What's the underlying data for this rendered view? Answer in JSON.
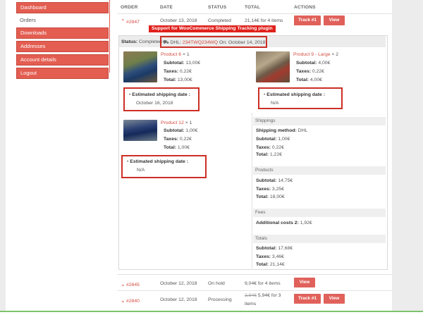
{
  "sidebar": {
    "items": [
      {
        "label": "Dashboard",
        "active": true
      },
      {
        "label": "Orders",
        "active": false
      },
      {
        "label": "Downloads",
        "active": true
      },
      {
        "label": "Addresses",
        "active": true
      },
      {
        "label": "Account details",
        "active": true
      },
      {
        "label": "Logout",
        "active": true
      }
    ]
  },
  "table": {
    "headers": [
      "ORDER",
      "DATE",
      "STATUS",
      "TOTAL",
      "ACTIONS"
    ]
  },
  "orders": [
    {
      "number": "#2847",
      "date": "October 13, 2018",
      "status": "Completed",
      "total": "21,14€",
      "total_suffix": "for 4 items",
      "actions": [
        "Track #1",
        "View"
      ]
    },
    {
      "number": "#2845",
      "date": "October 12, 2018",
      "status": "On hold",
      "total": "9,04€",
      "total_suffix": "for 4 items",
      "actions": [
        "View"
      ]
    },
    {
      "number": "#2840",
      "date": "October 12, 2018",
      "status": "Processing",
      "total_old": "2,94€",
      "total": "5,94€",
      "total_suffix": "for 3",
      "total_suffix2": "items",
      "actions": [
        "Track #1",
        "View"
      ]
    }
  ],
  "plugin_label": "Support for WooCommerce Shipping Tracking plugin",
  "detail": {
    "status_label": "Status:",
    "status_value": "Completed",
    "tracking_carrier": "DHL:",
    "tracking_code": "234TWQ234WQ",
    "tracking_on": "On: October 14, 2018",
    "products": [
      {
        "name": "Product 6",
        "qty": "× 1",
        "subtotal": "13,00€",
        "taxes": "0,22€",
        "total": "13,00€",
        "est_label": "Estimated shipping date :",
        "est_value": "October 16, 2018"
      },
      {
        "name": "Product 9 - Large",
        "qty": "× 2",
        "subtotal": "4,00€",
        "taxes": "0,22€",
        "total": "4,00€",
        "est_label": "Estimated shipping date :",
        "est_value": "N/A"
      },
      {
        "name": "Product 12",
        "qty": "× 1",
        "subtotal": "1,00€",
        "taxes": "0,22€",
        "total": "1,00€",
        "est_label": "Estimated shipping date :",
        "est_value": "N/A"
      }
    ],
    "labels": {
      "subtotal": "Subtotal:",
      "taxes": "Taxes:",
      "total": "Total:"
    },
    "shippings": {
      "heading": "Shippings",
      "method_label": "Shipping method:",
      "method": "DHL",
      "subtotal": "1,00€",
      "taxes": "0,22€",
      "total": "1,22€"
    },
    "products_summary": {
      "heading": "Products",
      "subtotal": "14,75€",
      "taxes": "3,25€",
      "total": "18,00€"
    },
    "fees": {
      "heading": "Fees",
      "label": "Additional costs 2:",
      "value": "1,92€"
    },
    "totals": {
      "heading": "Totals",
      "subtotal": "17,68€",
      "taxes": "3,46€",
      "total": "21,14€"
    }
  }
}
